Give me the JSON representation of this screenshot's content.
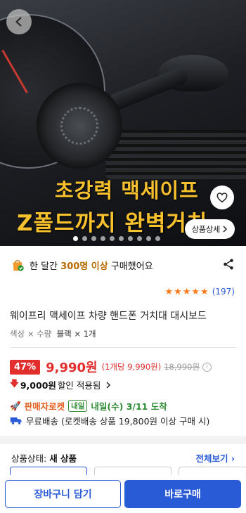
{
  "hero": {
    "headline_line1": "초강력 맥세이프",
    "headline_line2": "Z폴드까지 완벽거치",
    "detail_button": "상품상세",
    "dot_count": 10,
    "active_dot_index": 0
  },
  "purchase_stat": {
    "prefix": "한 달간",
    "count": "300명 이상",
    "suffix": "구매했어요"
  },
  "rating": {
    "stars": 5,
    "review_count": "(197)"
  },
  "product": {
    "title": "웨이프리 맥세이프 차량 핸드폰 거치대 대시보드",
    "option_label": "색상 × 수량",
    "option_value": "블랙 × 1개"
  },
  "price": {
    "discount_pct": "47%",
    "sale_price": "9,990원",
    "unit_price": "(1개당 9,990원)",
    "original_price": "18,990원",
    "discount_amount": "9,000원",
    "discount_text": "할인 적용됨"
  },
  "delivery": {
    "rocket_label": "판매자로켓",
    "tomorrow_badge": "내일",
    "eta": "내일(수) 3/11 도착",
    "free_shipping": "무료배송 (로켓배송 상품 19,800원 이상 구매 시)"
  },
  "condition": {
    "label": "상품상태:",
    "value": "새 상품",
    "see_all": "전체보기"
  },
  "bottom": {
    "cart_label": "장바구니 담기",
    "buy_label": "바로구매"
  },
  "colors": {
    "accent_blue": "#2a5bd7",
    "sale_red": "#e32e2e",
    "headline_yellow": "#f7c12e",
    "delivery_green": "#2c8a32",
    "rocket_orange": "#e35a1b"
  }
}
